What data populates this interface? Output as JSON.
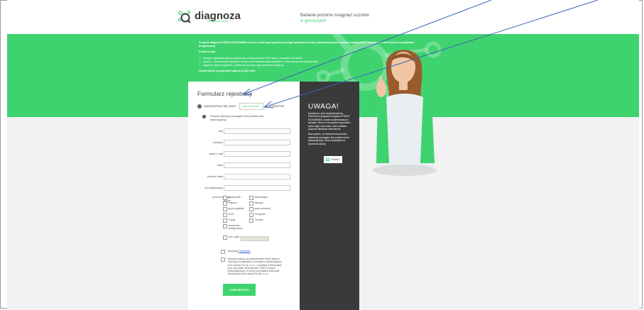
{
  "header": {
    "logo_text": "diagnoza",
    "logo_sub": "PRZED EGZAMINEM",
    "tagline_line1": "Badanie poziomu osiągnięć uczniów",
    "tagline_line2": "w gimnazjach"
  },
  "intro": {
    "p1": "Program diagnoza PRZED EGZAMINEM w formie próbnego egzaminu pomaga sprawdzić poziom opanowania przez uczniów wiadomości i umiejętności określonych w podstawie programowej.",
    "offer_title": "Portal oferuje:",
    "items": [
      "arkusze egzaminacyjne przygotowane według zaleceń CKE wraz z zasadami oceniania,",
      "raporty – dla dyrektora statystyki szkoły na tle wyników ogólnopolskich, a dla nauczyciela analiza klas,",
      "wygodny system zgłoszeń, pobierania arkuszy, wprowadzania wyników."
    ],
    "footer": "Udział szkoły w programie zgłasza jej Dyrektor."
  },
  "form": {
    "title": "Formularz rejestracji",
    "register_as": "ZAREJESTRUJ SIĘ JAKO:",
    "role_teacher": "NAUCZYCIEL",
    "role_director": "DYREKTOR",
    "note": "Podczas rejestracji wymagane jest podanie kodu aktywacyjnego.",
    "fields": [
      "imię",
      "nazwisko",
      "adres e-mail",
      "hasło",
      "powtórz hasło",
      "kod aktywacyjny"
    ],
    "subjects_label": "przedmioty jakich uczysz",
    "subjects_left": [
      "język polski",
      "Historia",
      "język angielski",
      "WOS",
      "Fizyka",
      "Nauczanie zintegrowane",
      "Inne, jakie?"
    ],
    "subjects_right": [
      "Matematyka",
      "Biologia",
      "język niemiecki",
      "Geografia",
      "Chemia"
    ],
    "accept_prefix": "Akceptuję",
    "accept_link": "Regulamin",
    "consent": "Wyrażam zgodę na przetwarzanie moich danych osobowych zawartych w formularzu rejestracyjnym przez Nowa Era Sp. z o.o. z siedzibą w Warszawie przy ulicy Aleje Jerozolimskie 146D w celach marketingowych, w formie przesyłania informacji handlowych przez Nowa Era Sp. z o.o.",
    "submit": "ZAREJESTRUJ"
  },
  "warning": {
    "title": "UWAGA!",
    "p1": "Dyrektorze, jeśli zarejestrował się Pan/Pani w programie diagnoza PRZED EGZAMINEM, został zarejestrowany w serwisie. Wróć do formularza logowania i wpisz login oraz hasło, które ustaliłeś podczas składania zamówienia.",
    "p2": "Nauczycielu, do zakończenia procesu rejestracji wymagane jest podanie kodu aktywacyjnego, który otrzymałeś od Dyrektora szkoły.",
    "help": "POMOC"
  },
  "colors": {
    "accent": "#3fd36f",
    "dark_panel": "#3a3a3a",
    "arrow": "#3b67b8"
  }
}
